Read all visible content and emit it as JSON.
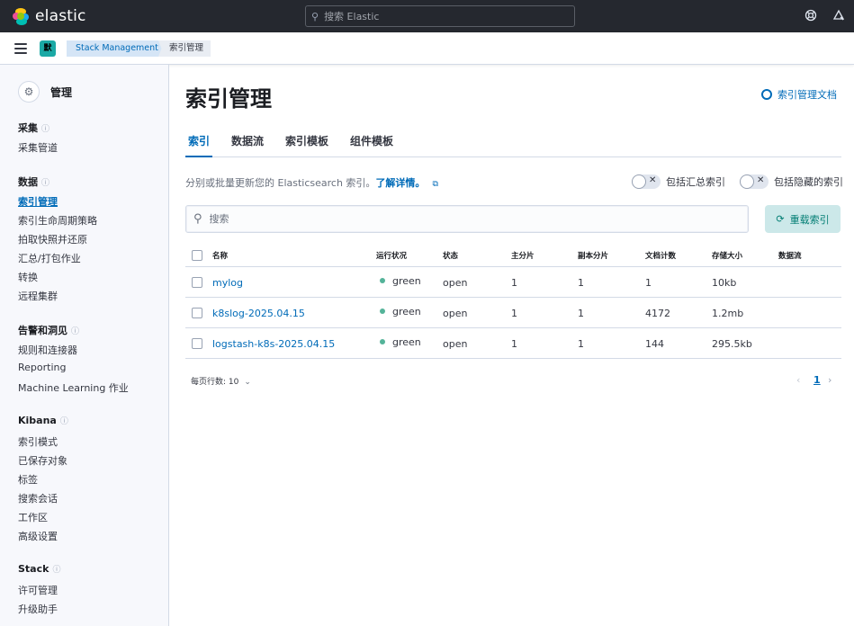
{
  "header": {
    "app_name": "elastic",
    "search_placeholder": "搜索 Elastic",
    "help_icon": "help-icon",
    "news_icon": "newsfeed-icon"
  },
  "breadcrumbs": {
    "space_badge": "默",
    "items": [
      "Stack Management",
      "索引管理"
    ]
  },
  "sidebar": {
    "title": "管理",
    "groups": [
      {
        "label": "采集",
        "items": [
          "采集管道"
        ]
      },
      {
        "label": "数据",
        "items": [
          "索引管理",
          "索引生命周期策略",
          "拍取快照并还原",
          "汇总/打包作业",
          "转换",
          "远程集群"
        ]
      },
      {
        "label": "告警和洞见",
        "items": [
          "规则和连接器",
          "Reporting",
          "Machine Learning 作业"
        ]
      },
      {
        "label": "Kibana",
        "items": [
          "索引模式",
          "已保存对象",
          "标签",
          "搜索会话",
          "工作区",
          "高级设置"
        ]
      },
      {
        "label": "Stack",
        "items": [
          "许可管理",
          "升级助手"
        ]
      }
    ],
    "active_item": "索引管理"
  },
  "main": {
    "title": "索引管理",
    "doc_link": "索引管理文档",
    "tabs": [
      "索引",
      "数据流",
      "索引模板",
      "组件模板"
    ],
    "active_tab": "索引",
    "description": "分别或批量更新您的 Elasticsearch 索引。",
    "learn_more": "了解详情。",
    "toggle_rollup": "包括汇总索引",
    "toggle_hidden": "包括隐藏的索引",
    "search_placeholder": "搜索",
    "reload_label": "重载索引",
    "columns": [
      "名称",
      "运行状况",
      "状态",
      "主分片",
      "副本分片",
      "文档计数",
      "存储大小",
      "数据流"
    ],
    "rows": [
      {
        "name": "mylog",
        "health": "green",
        "status": "open",
        "primaries": "1",
        "replicas": "1",
        "docs": "1",
        "size": "10kb",
        "stream": ""
      },
      {
        "name": "k8slog-2025.04.15",
        "health": "green",
        "status": "open",
        "primaries": "1",
        "replicas": "1",
        "docs": "4172",
        "size": "1.2mb",
        "stream": ""
      },
      {
        "name": "logstash-k8s-2025.04.15",
        "health": "green",
        "status": "open",
        "primaries": "1",
        "replicas": "1",
        "docs": "144",
        "size": "295.5kb",
        "stream": ""
      }
    ],
    "rows_per_page": "每页行数: 10",
    "current_page": "1"
  },
  "colors": {
    "accent": "#006bb8",
    "header_bg": "#25282f",
    "health_green": "#54b399"
  }
}
